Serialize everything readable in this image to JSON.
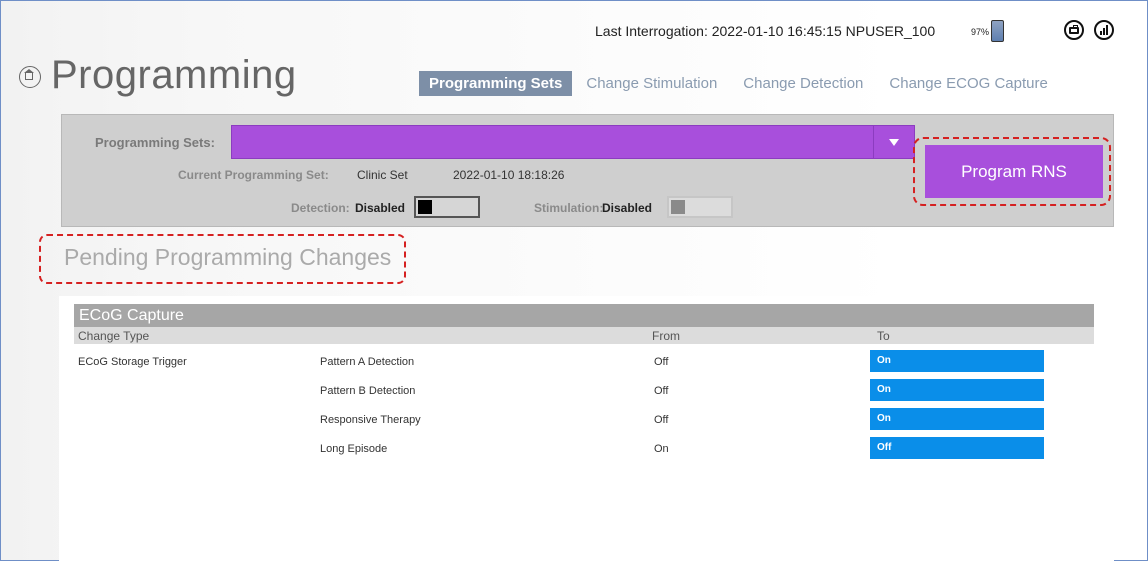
{
  "status": {
    "interrogation": "Last Interrogation: 2022-01-10 16:45:15  NPUSER_100",
    "battery": "97%"
  },
  "icons": {
    "home": "home-icon",
    "battery": "battery-icon",
    "case": "briefcase-icon",
    "signal": "signal-icon"
  },
  "title": "Programming",
  "tabs": [
    "Programming Sets",
    "Change Stimulation",
    "Change Detection",
    "Change ECOG Capture"
  ],
  "programming": {
    "sets_label": "Programming Sets:",
    "current_label": "Current Programming Set:",
    "current_value": "Clinic Set",
    "current_date": "2022-01-10 18:18:26",
    "detection_label": "Detection:",
    "detection_value": "Disabled",
    "stimulation_label": "Stimulation:",
    "stimulation_value": "Disabled",
    "program_button": "Program RNS"
  },
  "pending_title": "Pending Programming Changes",
  "changes": {
    "section": "ECoG Capture",
    "columns": [
      "Change Type",
      "From",
      "To"
    ],
    "rows": [
      {
        "type": "ECoG Storage Trigger",
        "item": "Pattern A Detection",
        "from": "Off",
        "to": "On"
      },
      {
        "type": "",
        "item": "Pattern B Detection",
        "from": "Off",
        "to": "On"
      },
      {
        "type": "",
        "item": "Responsive Therapy",
        "from": "Off",
        "to": "On"
      },
      {
        "type": "",
        "item": "Long Episode",
        "from": "On",
        "to": "Off"
      }
    ]
  },
  "colors": {
    "accent_purple": "#a84fdc",
    "to_blue": "#0a8ee9",
    "highlight_dash": "#d52121"
  }
}
